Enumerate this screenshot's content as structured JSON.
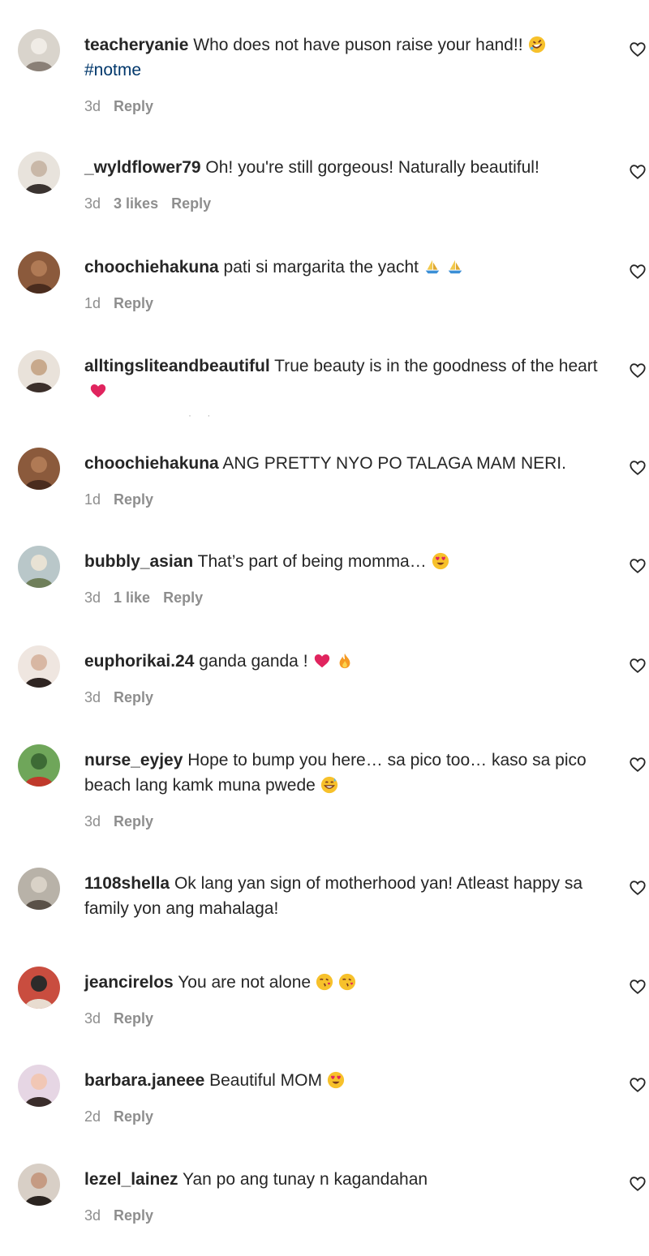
{
  "comments": [
    {
      "username": "teacheryanie",
      "text": "Who does not have puson raise your hand!!",
      "emojis": [
        "rofl-emoji"
      ],
      "hashtag": "#notme",
      "time": "3d",
      "likes": "",
      "reply": "Reply"
    },
    {
      "username": "_wyldflower79",
      "text": "Oh! you're still gorgeous! Naturally beautiful!",
      "emojis": [],
      "time": "3d",
      "likes": "3 likes",
      "reply": "Reply"
    },
    {
      "username": "choochiehakuna",
      "text": "pati si margarita the yacht",
      "emojis": [
        "sailboat-emoji",
        "sailboat-emoji"
      ],
      "time": "1d",
      "likes": "",
      "reply": "Reply"
    },
    {
      "username": "alltingsliteandbeautiful",
      "text": "True beauty is in the goodness of the heart",
      "emojis": [
        "red-heart-emoji"
      ],
      "time": "",
      "likes": "",
      "reply": ""
    },
    {
      "username": "choochiehakuna",
      "text": "ANG PRETTY NYO PO TALAGA MAM NERI.",
      "emojis": [],
      "time": "1d",
      "likes": "",
      "reply": "Reply"
    },
    {
      "username": "bubbly_asian",
      "text": "That’s part of being momma…",
      "emojis": [
        "heart-eyes-emoji"
      ],
      "time": "3d",
      "likes": "1 like",
      "reply": "Reply"
    },
    {
      "username": "euphorikai.24",
      "text": "ganda ganda !",
      "emojis": [
        "red-heart-emoji",
        "fire-emoji"
      ],
      "time": "3d",
      "likes": "",
      "reply": "Reply"
    },
    {
      "username": "nurse_eyjey",
      "text": "Hope to bump you here… sa pico too… kaso sa pico beach lang kamk muna pwede",
      "emojis": [
        "grin-sweat-emoji"
      ],
      "time": "3d",
      "likes": "",
      "reply": "Reply"
    },
    {
      "username": "1108shella",
      "text": "Ok lang yan sign of motherhood yan! Atleast happy sa family yon ang mahalaga!",
      "emojis": [],
      "time": "",
      "likes": "",
      "reply": ""
    },
    {
      "username": "jeancirelos",
      "text": "You are not alone",
      "emojis": [
        "kiss-emoji",
        "kiss-emoji"
      ],
      "time": "3d",
      "likes": "",
      "reply": "Reply"
    },
    {
      "username": "barbara.janeee",
      "text": "Beautiful MOM",
      "emojis": [
        "heart-eyes-emoji"
      ],
      "time": "2d",
      "likes": "",
      "reply": "Reply"
    },
    {
      "username": "lezel_lainez",
      "text": "Yan po ang tunay n kagandahan",
      "emojis": [],
      "time": "3d",
      "likes": "",
      "reply": "Reply"
    }
  ],
  "icons": {
    "like": "heart-outline-icon"
  },
  "colors": {
    "text": "#262626",
    "meta": "#8e8e8e",
    "hashtag": "#00376b",
    "heart": "#e0245e"
  }
}
